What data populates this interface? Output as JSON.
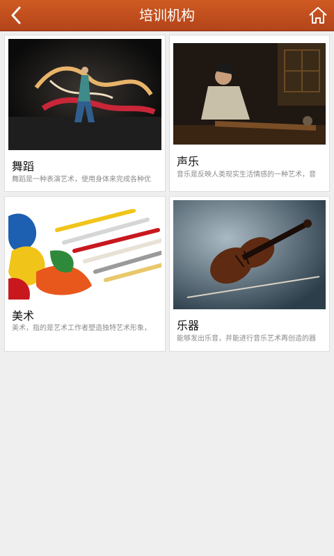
{
  "header": {
    "title": "培训机构"
  },
  "cards": [
    {
      "title": "舞蹈",
      "desc": "舞蹈是一种表演艺术，使用身体来完成各种优"
    },
    {
      "title": "声乐",
      "desc": "音乐是反映人类现实生活情感的一种艺术，音"
    },
    {
      "title": "美术",
      "desc": "美术，指的是艺术工作者塑造独特艺术形象，"
    },
    {
      "title": "乐器",
      "desc": "能够发出乐音，并能进行音乐艺术再创造的器"
    }
  ]
}
